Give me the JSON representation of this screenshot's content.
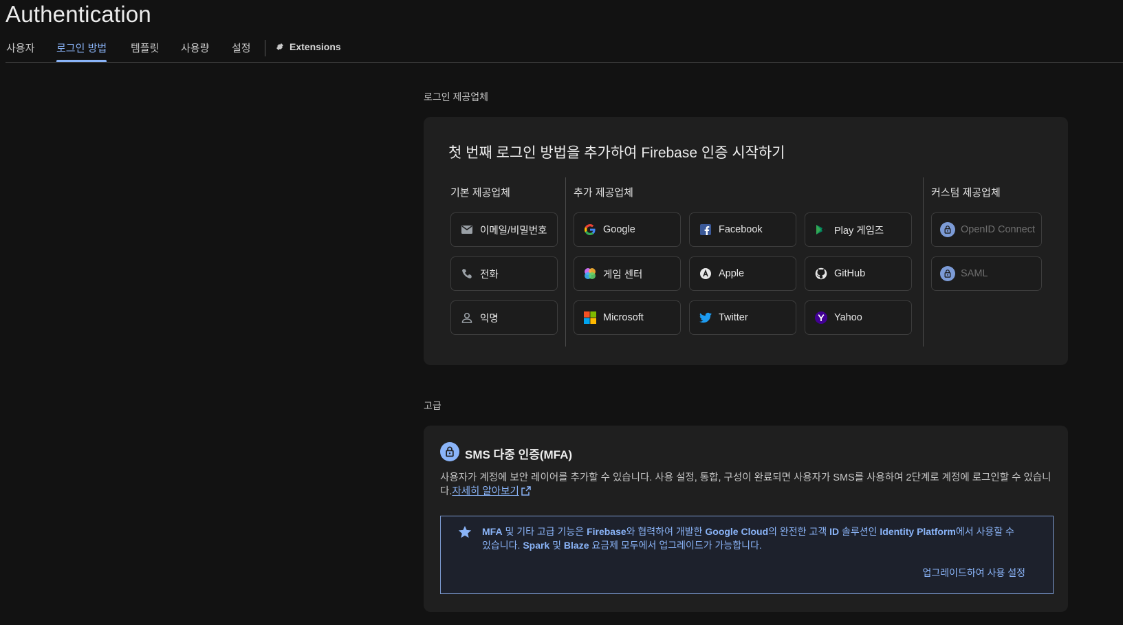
{
  "page": {
    "title": "Authentication"
  },
  "tabs": [
    {
      "label": "사용자"
    },
    {
      "label": "로그인 방법"
    },
    {
      "label": "템플릿"
    },
    {
      "label": "사용량"
    },
    {
      "label": "설정"
    },
    {
      "label": "Extensions"
    }
  ],
  "signin": {
    "section_label": "로그인 제공업체",
    "heading": "첫 번째 로그인 방법을 추가하여 Firebase 인증 시작하기",
    "native": {
      "title": "기본 제공업체",
      "items": [
        {
          "label": "이메일/비밀번호",
          "icon": "mail-icon"
        },
        {
          "label": "전화",
          "icon": "phone-icon"
        },
        {
          "label": "익명",
          "icon": "person-icon"
        }
      ]
    },
    "additional": {
      "title": "추가 제공업체",
      "items": [
        {
          "label": "Google",
          "icon": "google-icon"
        },
        {
          "label": "Facebook",
          "icon": "facebook-icon"
        },
        {
          "label": "Play 게임즈",
          "icon": "play-games-icon"
        },
        {
          "label": "게임 센터",
          "icon": "game-center-icon"
        },
        {
          "label": "Apple",
          "icon": "apple-icon"
        },
        {
          "label": "GitHub",
          "icon": "github-icon"
        },
        {
          "label": "Microsoft",
          "icon": "microsoft-icon"
        },
        {
          "label": "Twitter",
          "icon": "twitter-icon"
        },
        {
          "label": "Yahoo",
          "icon": "yahoo-icon"
        }
      ]
    },
    "custom": {
      "title": "커스텀 제공업체",
      "items": [
        {
          "label": "OpenID Connect",
          "icon": "lock-icon"
        },
        {
          "label": "SAML",
          "icon": "lock-icon"
        }
      ]
    }
  },
  "advanced": {
    "section_label": "고급",
    "mfa": {
      "title": "SMS 다중 인증(MFA)",
      "description": "사용자가 계정에 보안 레이어를 추가할 수 있습니다. 사용 설정, 통합, 구성이 완료되면 사용자가 SMS를 사용하여 2단계로 계정에 로그인할 수 있습니다.",
      "learn_more": "자세히 알아보기",
      "notice": {
        "t1": "MFA",
        "t2": " 및 기타 고급 기능은 ",
        "t3": "Firebase",
        "t4": "와 협력하여 개발한 ",
        "t5": "Google Cloud",
        "t6": "의 완전한 고객 ",
        "t7": "ID",
        "t8": " 솔루션인 ",
        "t9": "Identity Platform",
        "t10": "에서 사용할 수 있습니다. ",
        "t11": "Spark",
        "t12": " 및 ",
        "t13": "Blaze",
        "t14": " 요금제 모두에서 업그레이드가 가능합니다."
      },
      "upgrade_link": "업그레이드하여 사용 설정"
    }
  },
  "colors": {
    "accent": "#8ab4f8",
    "background": "#121212",
    "card": "#1f1f1f"
  }
}
